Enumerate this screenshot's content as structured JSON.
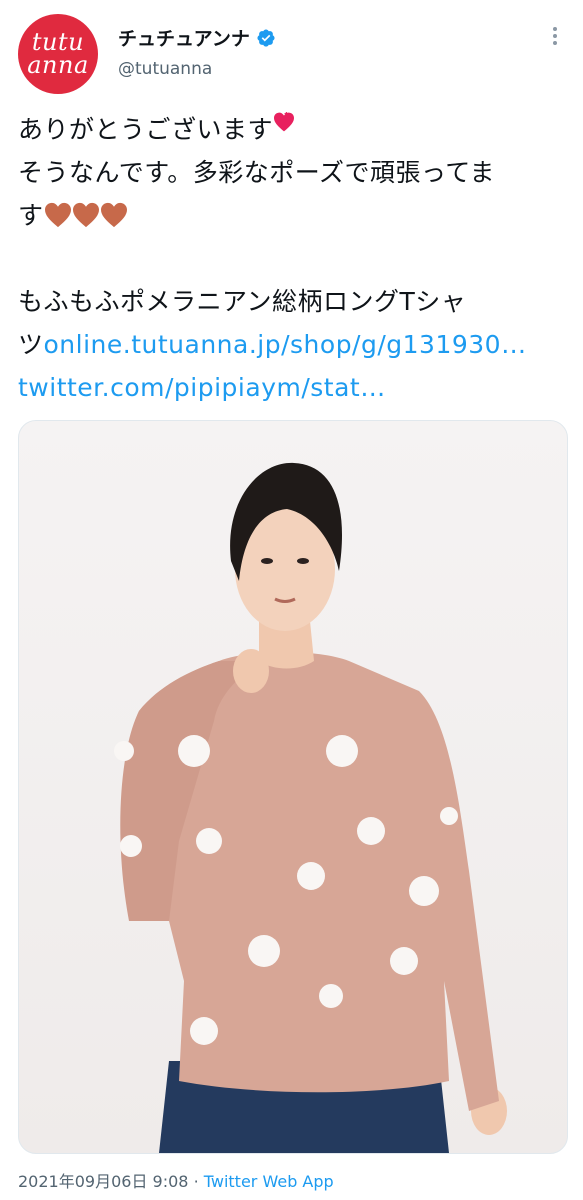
{
  "account": {
    "avatar_lines": [
      "tutu",
      "anna"
    ],
    "display_name": "チュチュアンナ",
    "handle": "@tutuanna",
    "verified": true
  },
  "tweet": {
    "line1": "ありがとうございます",
    "line2": "そうなんです。多彩なポーズで頑張ってま",
    "line3": "す",
    "line5": "もふもふポメラニアン総柄ロングTシャ",
    "line6_prefix": "ツ",
    "link1": "online.tutuanna.jp/shop/g/g131930…",
    "link2": "twitter.com/pipipiaym/stat…",
    "emoji": {
      "sparkling_hearts": "sparkling-heart-emoji",
      "brown_hearts": 3
    }
  },
  "media": {
    "description_icon": "photo-of-model-wearing-pink-long-sleeve-pomeranian-print-shirt"
  },
  "footer": {
    "timestamp": "2021年09月06日 9:08",
    "separator": "·",
    "source": "Twitter Web App"
  },
  "colors": {
    "brand_red": "#e02a3f",
    "link_blue": "#1d9bf0",
    "heart_brown": "#c7694a",
    "heart_pink": "#e8205e"
  }
}
